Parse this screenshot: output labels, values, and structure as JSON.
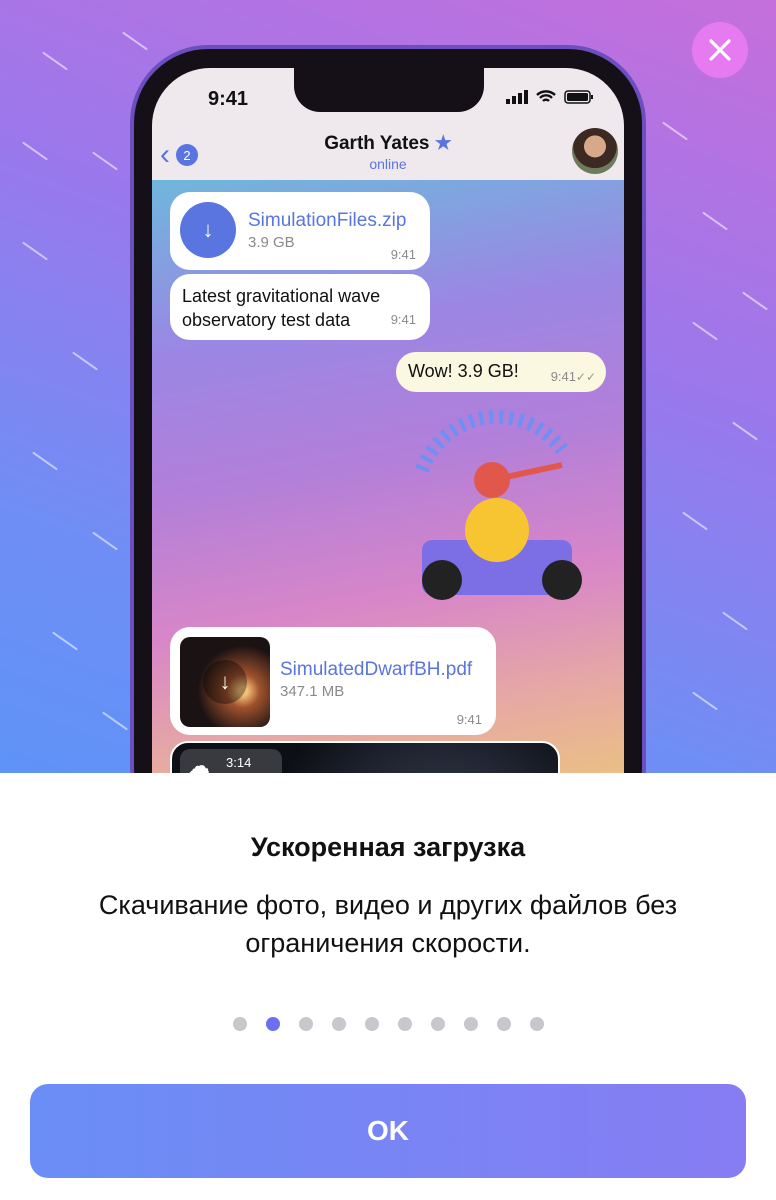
{
  "phone": {
    "status_time": "9:41",
    "header": {
      "back_count": "2",
      "contact_name": "Garth Yates",
      "contact_status": "online"
    },
    "messages": [
      {
        "file_name": "SimulationFiles.zip",
        "file_size": "3.9 GB",
        "time": "9:41"
      },
      {
        "text": "Latest gravitational wave observatory test data",
        "time": "9:41"
      },
      {
        "text": "Wow! 3.9 GB!",
        "time": "9:41"
      },
      {
        "file_name": "SimulatedDwarfBH.pdf",
        "file_size": "347.1 MB",
        "time": "9:41"
      },
      {
        "video_duration": "3:14"
      }
    ]
  },
  "feature": {
    "title": "Ускоренная загрузка",
    "description": "Скачивание фото, видео и других файлов без ограничения скорости."
  },
  "pager": {
    "count": 10,
    "active_index": 1
  },
  "ok_label": "OK",
  "colors": {
    "accent": "#6b6ff0",
    "link": "#5a74e0",
    "close": "#e67af0"
  }
}
